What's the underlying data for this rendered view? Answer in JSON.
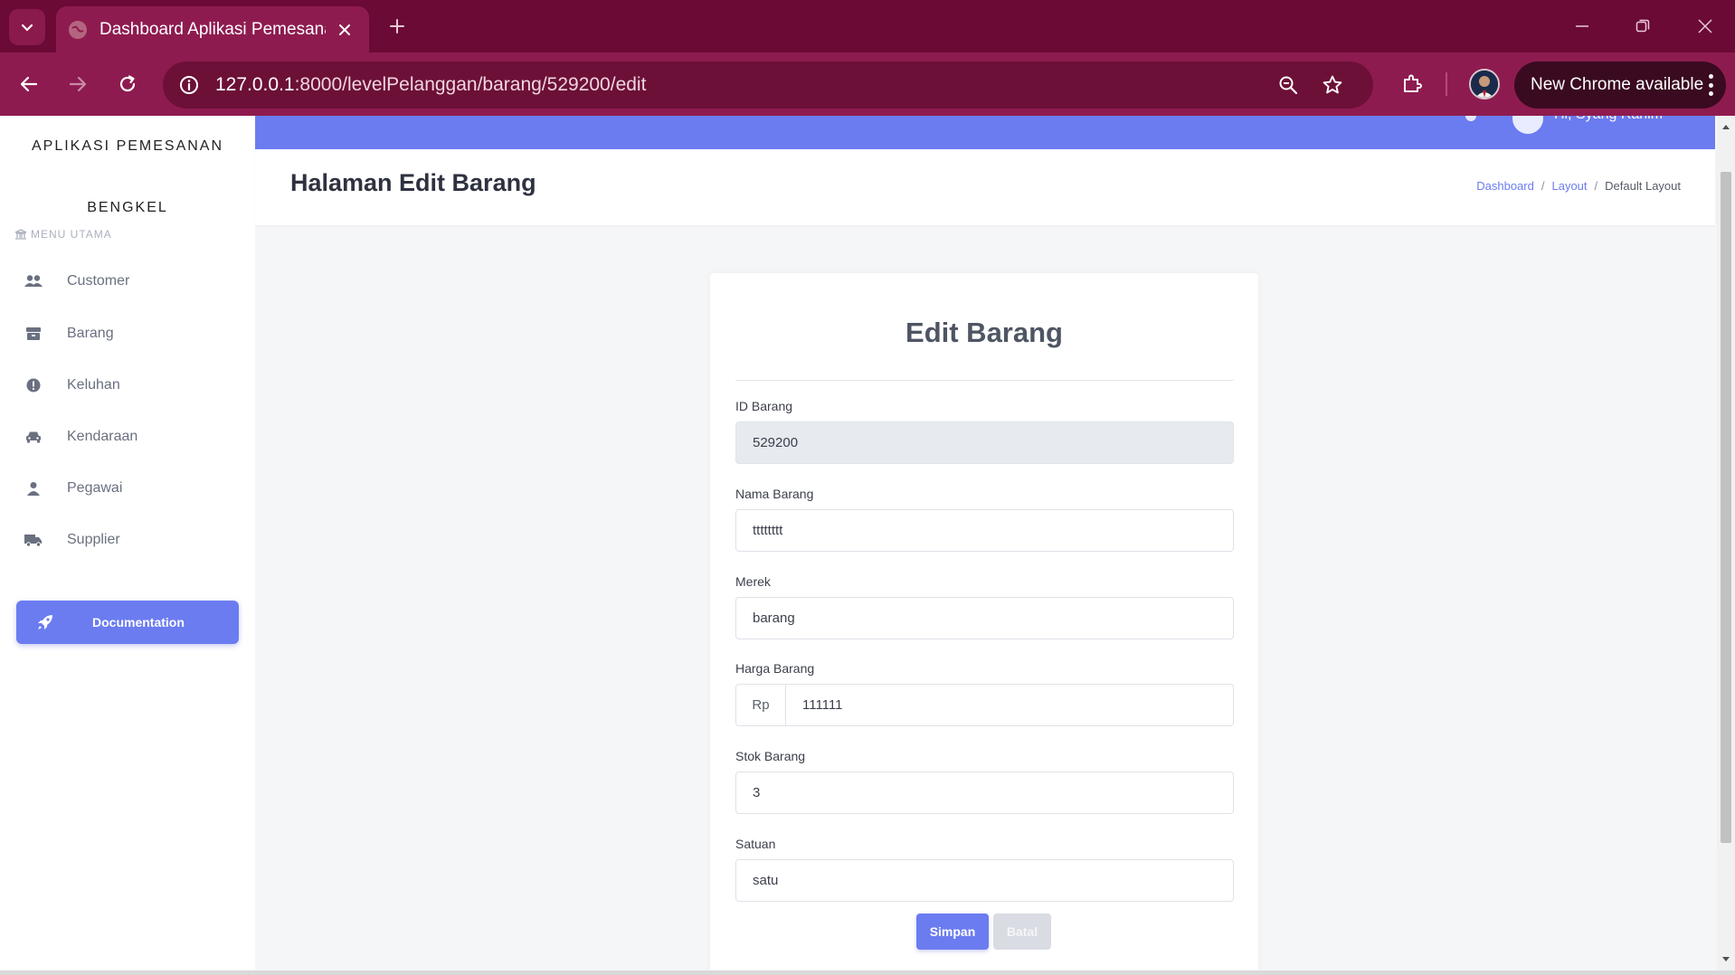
{
  "browser": {
    "tab_title": "Dashboard Aplikasi Pemesanan",
    "url_host": "127.0.0.1",
    "url_rest": ":8000/levelPelanggan/barang/529200/edit",
    "update_label": "New Chrome available",
    "theme_color": "#8e1b4f"
  },
  "sidebar": {
    "brand_line1": "APLIKASI PEMESANAN",
    "brand_line2": "BENGKEL",
    "menu_heading": "MENU UTAMA",
    "items": [
      {
        "label": "Customer",
        "icon": "users-icon"
      },
      {
        "label": "Barang",
        "icon": "box-icon"
      },
      {
        "label": "Keluhan",
        "icon": "alert-circle-icon"
      },
      {
        "label": "Kendaraan",
        "icon": "car-icon"
      },
      {
        "label": "Pegawai",
        "icon": "user-icon"
      },
      {
        "label": "Supplier",
        "icon": "truck-icon"
      }
    ],
    "doc_button": "Documentation",
    "accent": "#6b7cf0"
  },
  "topbar": {
    "user_name": "Hi, Syang Rahim"
  },
  "header": {
    "title": "Halaman Edit Barang",
    "breadcrumb": [
      "Dashboard",
      "Layout",
      "Default Layout"
    ]
  },
  "form": {
    "title": "Edit Barang",
    "fields": {
      "id_barang": {
        "label": "ID Barang",
        "value": "529200"
      },
      "nama_barang": {
        "label": "Nama Barang",
        "value": "tttttttt"
      },
      "merek": {
        "label": "Merek",
        "value": "barang"
      },
      "harga_barang": {
        "label": "Harga Barang",
        "prefix": "Rp",
        "value": "111111"
      },
      "stok_barang": {
        "label": "Stok Barang",
        "value": "3"
      },
      "satuan": {
        "label": "Satuan",
        "value": "satu"
      }
    },
    "save_label": "Simpan",
    "cancel_label": "Batal"
  }
}
